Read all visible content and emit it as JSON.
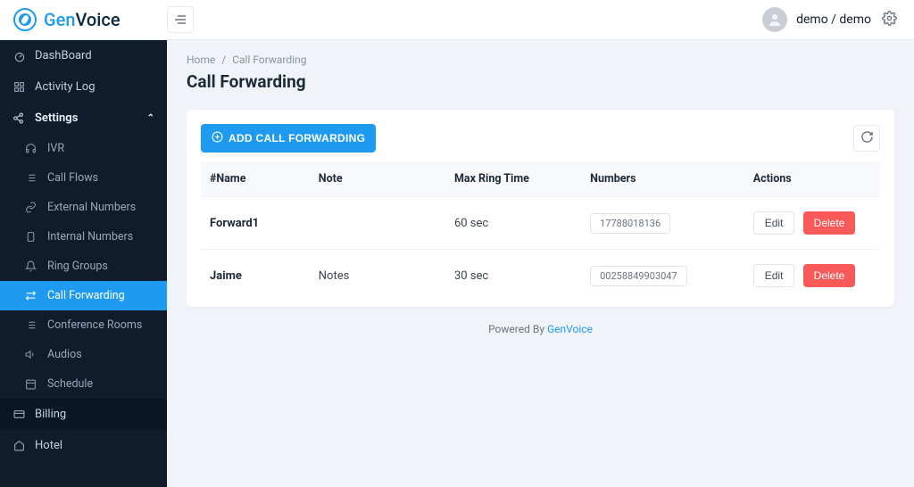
{
  "brand": {
    "gen": "Gen",
    "voice": "Voice"
  },
  "user": {
    "label": "demo / demo"
  },
  "sidebar": {
    "dashboard": "DashBoard",
    "activity": "Activity Log",
    "settings": "Settings",
    "ivr": "IVR",
    "callflows": "Call Flows",
    "externalnumbers": "External Numbers",
    "internalnumbers": "Internal Numbers",
    "ringgroups": "Ring Groups",
    "callforwarding": "Call Forwarding",
    "conference": "Conference Rooms",
    "audios": "Audios",
    "schedule": "Schedule",
    "billing": "Billing",
    "hotel": "Hotel"
  },
  "breadcrumb": {
    "home": "Home",
    "sep": "/",
    "page": "Call Forwarding"
  },
  "page": {
    "title": "Call Forwarding"
  },
  "buttons": {
    "add": "ADD CALL FORWARDING",
    "edit": "Edit",
    "delete": "Delete"
  },
  "table": {
    "headers": {
      "name": "#Name",
      "note": "Note",
      "ring": "Max Ring Time",
      "numbers": "Numbers",
      "actions": "Actions"
    },
    "rows": [
      {
        "name": "Forward1",
        "note": "",
        "ring": "60 sec",
        "number": "17788018136"
      },
      {
        "name": "Jaime",
        "note": "Notes",
        "ring": "30 sec",
        "number": "00258849903047"
      }
    ]
  },
  "footer": {
    "prefix": "Powered By ",
    "brand": "GenVoice"
  }
}
